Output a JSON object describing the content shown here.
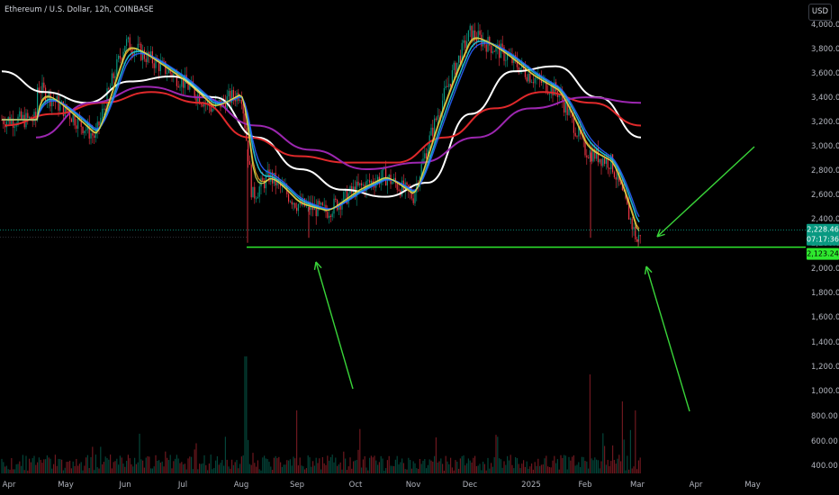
{
  "header": {
    "title": "Ethereum / U.S. Dollar, 12h, COINBASE",
    "currency": "USD"
  },
  "colors": {
    "background": "#000000",
    "candle_up": "#089981",
    "candle_down": "#f23645",
    "ma_white": "#ffffff",
    "ma_red": "#e0292b",
    "ma_purple": "#9c27b0",
    "ma_teal": "#26c6da",
    "ma_blue": "#2962ff",
    "ma_orange": "#f5a623",
    "ma_yellow": "#d4e157",
    "support_line": "#2ee82e",
    "arrows": "#39d439",
    "price_badge": "#089981",
    "support_badge": "#2ee82e"
  },
  "chart_data": {
    "type": "candlestick",
    "title": "Ethereum / U.S. Dollar, 12h, COINBASE",
    "currency": "USD",
    "price_axis": {
      "ylim": [
        2000,
        4000
      ],
      "ticks": [
        "4,000.00",
        "3,800.00",
        "3,600.00",
        "3,400.00",
        "3,200.00",
        "3,000.00",
        "2,800.00",
        "2,600.00",
        "2,400.00",
        "2,200.00",
        "2,000.00",
        "1,800.00",
        "1,600.00",
        "1,400.00",
        "1,200.00",
        "1,000.00",
        "800.00",
        "600.00",
        "400.00"
      ],
      "scale": "log"
    },
    "x_axis": {
      "labels": [
        "Apr",
        "May",
        "Jun",
        "Jul",
        "Aug",
        "Sep",
        "Oct",
        "Nov",
        "Dec",
        "2025",
        "Feb",
        "Mar",
        "Apr",
        "May"
      ]
    },
    "current_price": {
      "value": "2,228.46",
      "countdown": "07:17:36"
    },
    "support_level": {
      "value": "2,123.24"
    },
    "price_path": [
      [
        "Apr",
        3520
      ],
      [
        "Apr-mid",
        3350
      ],
      [
        "May",
        3050
      ],
      [
        "May-mid",
        2900
      ],
      [
        "Jun",
        3800
      ],
      [
        "Jun-mid",
        3600
      ],
      [
        "Jul",
        3400
      ],
      [
        "Jul-mid",
        3150
      ],
      [
        "Aug",
        3300
      ],
      [
        "Aug-early",
        2450
      ],
      [
        "Aug-mid",
        2600
      ],
      [
        "Sep",
        2400
      ],
      [
        "Sep-mid",
        2350
      ],
      [
        "Oct",
        2500
      ],
      [
        "Oct-mid",
        2600
      ],
      [
        "Nov",
        2450
      ],
      [
        "Nov-mid",
        3200
      ],
      [
        "Dec",
        3900
      ],
      [
        "Dec-mid",
        3700
      ],
      [
        "2025",
        3450
      ],
      [
        "2025-mid",
        3300
      ],
      [
        "Feb",
        2800
      ],
      [
        "Feb-mid",
        2700
      ],
      [
        "Mar",
        2150
      ]
    ],
    "moving_averages": [
      {
        "color": "white",
        "path": [
          3500,
          3300,
          3200,
          3400,
          3450,
          3250,
          2900,
          2650,
          2500,
          2450,
          2550,
          3100,
          3500,
          3550,
          3250,
          2900
        ]
      },
      {
        "color": "red",
        "path": [
          3000,
          3100,
          3200,
          3300,
          3200,
          2900,
          2750,
          2700,
          2700,
          2900,
          3150,
          3300,
          3200,
          3000
        ]
      },
      {
        "color": "purple",
        "path": [
          2900,
          3200,
          3350,
          3250,
          3000,
          2800,
          2650,
          2700,
          2900,
          3150,
          3250,
          3200
        ]
      }
    ],
    "volume": "histogram along bottom of pane, spikes near Aug and Feb",
    "annotations": [
      "Horizontal support line at 2,123.24",
      "Upward arrow pointing to the early-September low",
      "Arrow pointing to the current price near 2,228",
      "Upward arrow pointing to the early-March low"
    ],
    "grid": false,
    "legend": "none"
  }
}
